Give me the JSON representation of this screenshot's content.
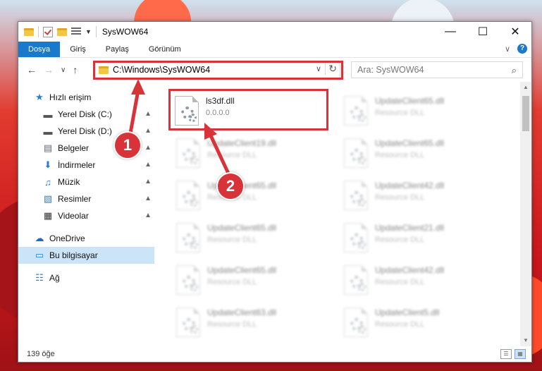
{
  "window": {
    "title": "SysWOW64",
    "minimize": "—",
    "maximize": "☐",
    "close": "✕"
  },
  "ribbon": {
    "tabs": [
      {
        "label": "Dosya",
        "active": true
      },
      {
        "label": "Giriş"
      },
      {
        "label": "Paylaş"
      },
      {
        "label": "Görünüm"
      }
    ],
    "expand": "∨",
    "help": "?"
  },
  "nav": {
    "back": "←",
    "forward": "→",
    "recent": "∨",
    "up": "↑"
  },
  "address": {
    "path": "C:\\Windows\\SysWOW64",
    "dropdown": "∨",
    "refresh": "↻"
  },
  "search": {
    "placeholder": "Ara: SysWOW64",
    "icon": "⌕"
  },
  "sidebar": {
    "items": [
      {
        "label": "Hızlı erişim",
        "icon": "star-icon",
        "glyph": "★",
        "color": "#2b7cd3",
        "level": 0
      },
      {
        "label": "Yerel Disk (C:)",
        "icon": "drive-icon",
        "glyph": "▬",
        "color": "#555555",
        "level": 1,
        "pinned": true
      },
      {
        "label": "Yerel Disk (D:)",
        "icon": "drive-icon",
        "glyph": "▬",
        "color": "#555555",
        "level": 1,
        "pinned": true
      },
      {
        "label": "Belgeler",
        "icon": "documents-icon",
        "glyph": "▤",
        "color": "#5a6b7b",
        "level": 1,
        "pinned": true
      },
      {
        "label": "İndirmeler",
        "icon": "download-icon",
        "glyph": "⬇",
        "color": "#2b7cd3",
        "level": 1,
        "pinned": true
      },
      {
        "label": "Müzik",
        "icon": "music-icon",
        "glyph": "♫",
        "color": "#2b7cd3",
        "level": 1,
        "pinned": true
      },
      {
        "label": "Resimler",
        "icon": "pictures-icon",
        "glyph": "▧",
        "color": "#3a7bbf",
        "level": 1,
        "pinned": true
      },
      {
        "label": "Videolar",
        "icon": "videos-icon",
        "glyph": "▦",
        "color": "#333333",
        "level": 1,
        "pinned": true
      },
      {
        "label": "OneDrive",
        "icon": "cloud-icon",
        "glyph": "☁",
        "color": "#1b6ac9",
        "level": 0,
        "gapBefore": true
      },
      {
        "label": "Bu bilgisayar",
        "icon": "computer-icon",
        "glyph": "▭",
        "color": "#2b7cd3",
        "level": 0,
        "selected": true
      },
      {
        "label": "Ağ",
        "icon": "network-icon",
        "glyph": "☷",
        "color": "#2b7cd3",
        "level": 0,
        "gapBefore": true
      }
    ],
    "pin_glyph": "▲"
  },
  "files": {
    "highlighted": {
      "name": "ls3df.dll",
      "sub": "0.0.0.0"
    },
    "blurred": [
      {
        "name": "UpdateClient65.dll",
        "sub": "Resource DLL"
      },
      {
        "name": "UpdateClient19.dll",
        "sub": "Resource DLL"
      },
      {
        "name": "UpdateClient65.dll",
        "sub": "Resource DLL"
      },
      {
        "name": "UpdateClient65.dll",
        "sub": "Resource DLL"
      },
      {
        "name": "UpdateClient42.dll",
        "sub": "Resource DLL"
      },
      {
        "name": "UpdateClient65.dll",
        "sub": "Resource DLL"
      },
      {
        "name": "UpdateClient21.dll",
        "sub": "Resource DLL"
      },
      {
        "name": "UpdateClient65.dll",
        "sub": "Resource DLL"
      },
      {
        "name": "UpdateClient42.dll",
        "sub": "Resource DLL"
      },
      {
        "name": "UpdateClient63.dll",
        "sub": "Resource DLL"
      },
      {
        "name": "UpdateClient5.dll",
        "sub": "Resource DLL"
      }
    ]
  },
  "status": {
    "count": "139 öğe"
  },
  "annotations": {
    "step1": "1",
    "step2": "2",
    "color": "#d9333a"
  }
}
